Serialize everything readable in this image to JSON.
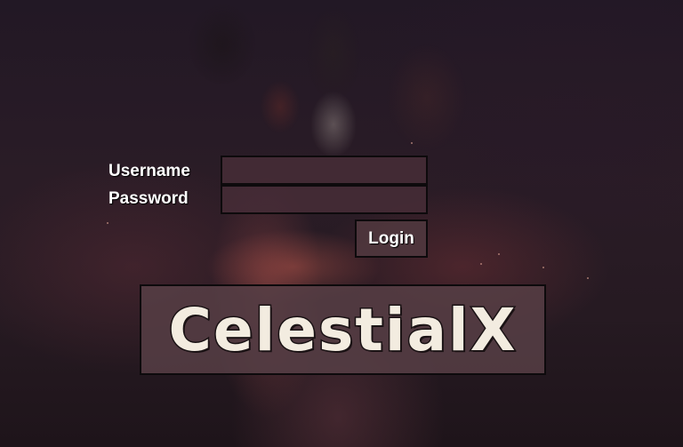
{
  "login_form": {
    "username_label": "Username",
    "password_label": "Password",
    "username_value": "",
    "password_value": "",
    "login_label": "Login"
  },
  "logo": {
    "text": "CelestialX"
  },
  "colors": {
    "field_bg": "#46323a",
    "border": "#0d0a0c",
    "logo_text": "#f3ece0"
  }
}
